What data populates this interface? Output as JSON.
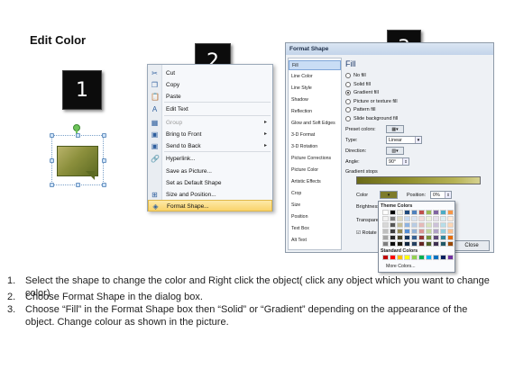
{
  "title": "Edit Color",
  "badges": [
    "1",
    "2",
    "3"
  ],
  "context_menu": {
    "items": [
      {
        "label": "Cut",
        "icon": "scissors-icon",
        "glyph": "✂",
        "state": "normal"
      },
      {
        "label": "Copy",
        "icon": "copy-icon",
        "glyph": "❐",
        "state": "normal"
      },
      {
        "label": "Paste",
        "icon": "paste-icon",
        "glyph": "📋",
        "state": "normal"
      },
      {
        "label": "Edit Text",
        "icon": "edit-text-icon",
        "glyph": "A",
        "state": "normal"
      },
      {
        "label": "Group",
        "icon": "group-icon",
        "glyph": "▦",
        "state": "disabled",
        "submenu": true
      },
      {
        "label": "Bring to Front",
        "icon": "bring-front-icon",
        "glyph": "▣",
        "state": "normal",
        "submenu": true
      },
      {
        "label": "Send to Back",
        "icon": "send-back-icon",
        "glyph": "▣",
        "state": "normal",
        "submenu": true
      },
      {
        "label": "Hyperlink...",
        "icon": "hyperlink-icon",
        "glyph": "🔗",
        "state": "normal"
      },
      {
        "label": "Save as Picture...",
        "icon": "",
        "glyph": "",
        "state": "normal"
      },
      {
        "label": "Set as Default Shape",
        "icon": "",
        "glyph": "",
        "state": "normal"
      },
      {
        "label": "Size and Position...",
        "icon": "size-position-icon",
        "glyph": "⊞",
        "state": "normal"
      },
      {
        "label": "Format Shape...",
        "icon": "format-shape-icon",
        "glyph": "◈",
        "state": "highlighted"
      }
    ]
  },
  "dialog": {
    "title": "Format Shape",
    "nav": [
      "Fill",
      "Line Color",
      "Line Style",
      "Shadow",
      "Reflection",
      "Glow and Soft Edges",
      "3-D Format",
      "3-D Rotation",
      "Picture Corrections",
      "Picture Color",
      "Artistic Effects",
      "Crop",
      "Size",
      "Position",
      "Text Box",
      "Alt Text"
    ],
    "active_nav": "Fill",
    "heading": "Fill",
    "options": [
      {
        "label": "No fill",
        "selected": false
      },
      {
        "label": "Solid fill",
        "selected": false
      },
      {
        "label": "Gradient fill",
        "selected": true
      },
      {
        "label": "Picture or texture fill",
        "selected": false
      },
      {
        "label": "Pattern fill",
        "selected": false
      },
      {
        "label": "Slide background fill",
        "selected": false
      }
    ],
    "preset_colors_label": "Preset colors:",
    "type_label": "Type:",
    "type_value": "Linear",
    "direction_label": "Direction:",
    "angle_label": "Angle:",
    "angle_value": "90°",
    "gradient_stops_label": "Gradient stops",
    "color_label": "Color",
    "position_label": "Position:",
    "position_value": "0%",
    "brightness_label": "Brightness",
    "transparency_label": "Transparency",
    "rotate_label": "Rotate with shape",
    "close_label": "Close"
  },
  "color_popup": {
    "theme_heading": "Theme Colors",
    "theme_colors": [
      [
        "#ffffff",
        "#000000",
        "#eeece1",
        "#1f497d",
        "#4f81bd",
        "#c0504d",
        "#9bbb59",
        "#8064a2",
        "#4bacc6",
        "#f79646"
      ],
      [
        "#f2f2f2",
        "#7f7f7f",
        "#ddd9c3",
        "#c6d9f0",
        "#dbe5f1",
        "#f2dcdb",
        "#ebf1dd",
        "#e5e0ec",
        "#dbeef3",
        "#fdeada"
      ],
      [
        "#d8d8d8",
        "#595959",
        "#c4bd97",
        "#8db3e2",
        "#b8cce4",
        "#e5b9b7",
        "#d7e3bc",
        "#ccc1d9",
        "#b7dde8",
        "#fbd5b5"
      ],
      [
        "#bfbfbf",
        "#3f3f3f",
        "#938953",
        "#548dd4",
        "#95b3d7",
        "#d99694",
        "#c3d69b",
        "#b2a2c7",
        "#92cddc",
        "#fac08f"
      ],
      [
        "#a5a5a5",
        "#262626",
        "#494429",
        "#17365d",
        "#366092",
        "#953734",
        "#76923c",
        "#5f497a",
        "#31859b",
        "#e36c09"
      ],
      [
        "#7f7f7f",
        "#0c0c0c",
        "#1d1b10",
        "#0f243e",
        "#244061",
        "#632423",
        "#4f6128",
        "#3f3151",
        "#205867",
        "#974806"
      ]
    ],
    "standard_heading": "Standard Colors",
    "standard_colors": [
      "#c00000",
      "#ff0000",
      "#ffc000",
      "#ffff00",
      "#92d050",
      "#00b050",
      "#00b0f0",
      "#0070c0",
      "#002060",
      "#7030a0"
    ],
    "more_colors": "More Colors..."
  },
  "steps": [
    {
      "num": "1.",
      "text": "Select the shape to change the color and Right click the object( click any object which you want to change color)"
    },
    {
      "num": "2.",
      "text": "Choose Format Shape in the dialog box."
    },
    {
      "num": "3.",
      "text": "Choose “Fill” in the Format Shape box then “Solid” or “Gradient” depending on the appearance of the object. Change colour as shown in the picture."
    }
  ]
}
